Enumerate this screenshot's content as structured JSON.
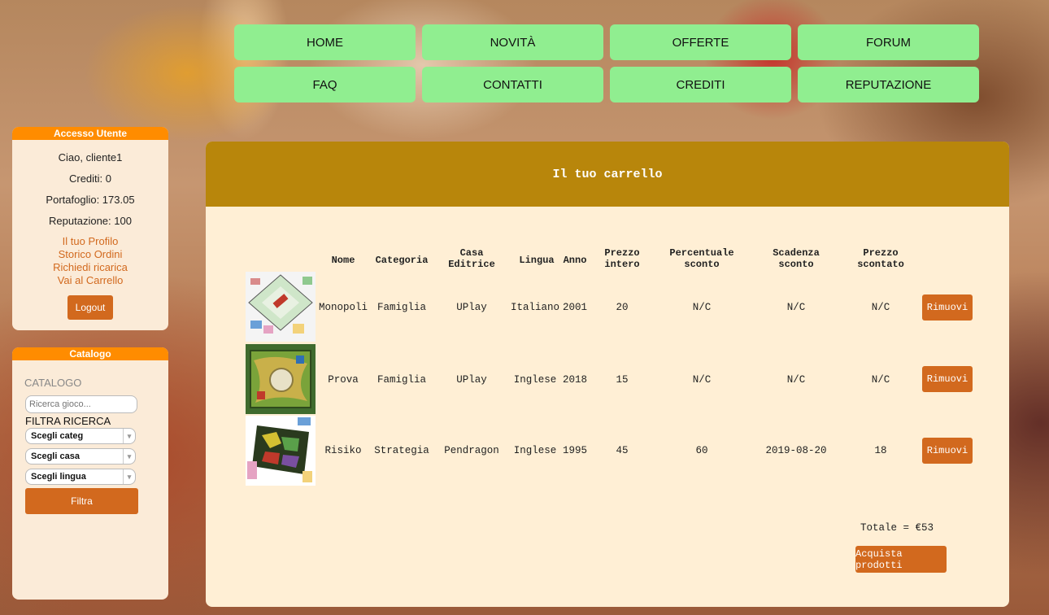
{
  "nav": {
    "row1": [
      "HOME",
      "NOVITÀ",
      "OFFERTE",
      "FORUM"
    ],
    "row2": [
      "FAQ",
      "CONTATTI",
      "CREDITI",
      "REPUTAZIONE"
    ]
  },
  "user_panel": {
    "title": "Accesso Utente",
    "greeting": "Ciao, cliente1",
    "crediti": "Crediti: 0",
    "portafoglio": "Portafoglio: 173.05",
    "reputazione": "Reputazione: 100",
    "links": [
      "Il tuo Profilo",
      "Storico Ordini",
      "Richiedi ricarica",
      "Vai al Carrello"
    ],
    "logout_label": "Logout"
  },
  "catalog_panel": {
    "title": "Catalogo",
    "heading": "CATALOGO",
    "search_placeholder": "Ricerca gioco...",
    "filter_heading": "FILTRA RICERCA",
    "selects": [
      "Scegli categ",
      "Scegli casa",
      "Scegli lingua"
    ],
    "filter_button": "Filtra"
  },
  "cart": {
    "title": "Il tuo carrello",
    "headers": {
      "nome": "Nome",
      "categoria": "Categoria",
      "casa1": "Casa",
      "casa2": "Editrice",
      "lingua": "Lingua",
      "anno": "Anno",
      "prezzo1": "Prezzo",
      "prezzo2": "intero",
      "perc1": "Percentuale",
      "perc2": "sconto",
      "scad1": "Scadenza",
      "scad2": "sconto",
      "scont1": "Prezzo",
      "scont2": "scontato"
    },
    "rows": [
      {
        "nome": "Monopoli",
        "categoria": "Famiglia",
        "casa": "UPlay",
        "lingua": "Italiano",
        "anno": "2001",
        "prezzo": "20",
        "percentuale": "N/C",
        "scadenza": "N/C",
        "scontato": "N/C",
        "remove": "Rimuovi"
      },
      {
        "nome": "Prova",
        "categoria": "Famiglia",
        "casa": "UPlay",
        "lingua": "Inglese",
        "anno": "2018",
        "prezzo": "15",
        "percentuale": "N/C",
        "scadenza": "N/C",
        "scontato": "N/C",
        "remove": "Rimuovi"
      },
      {
        "nome": "Risiko",
        "categoria": "Strategia",
        "casa": "Pendragon",
        "lingua": "Inglese",
        "anno": "1995",
        "prezzo": "45",
        "percentuale": "60",
        "scadenza": "2019-08-20",
        "scontato": "18",
        "remove": "Rimuovi"
      }
    ],
    "total": "Totale = €53",
    "buy_button": "Acquista prodotti"
  }
}
